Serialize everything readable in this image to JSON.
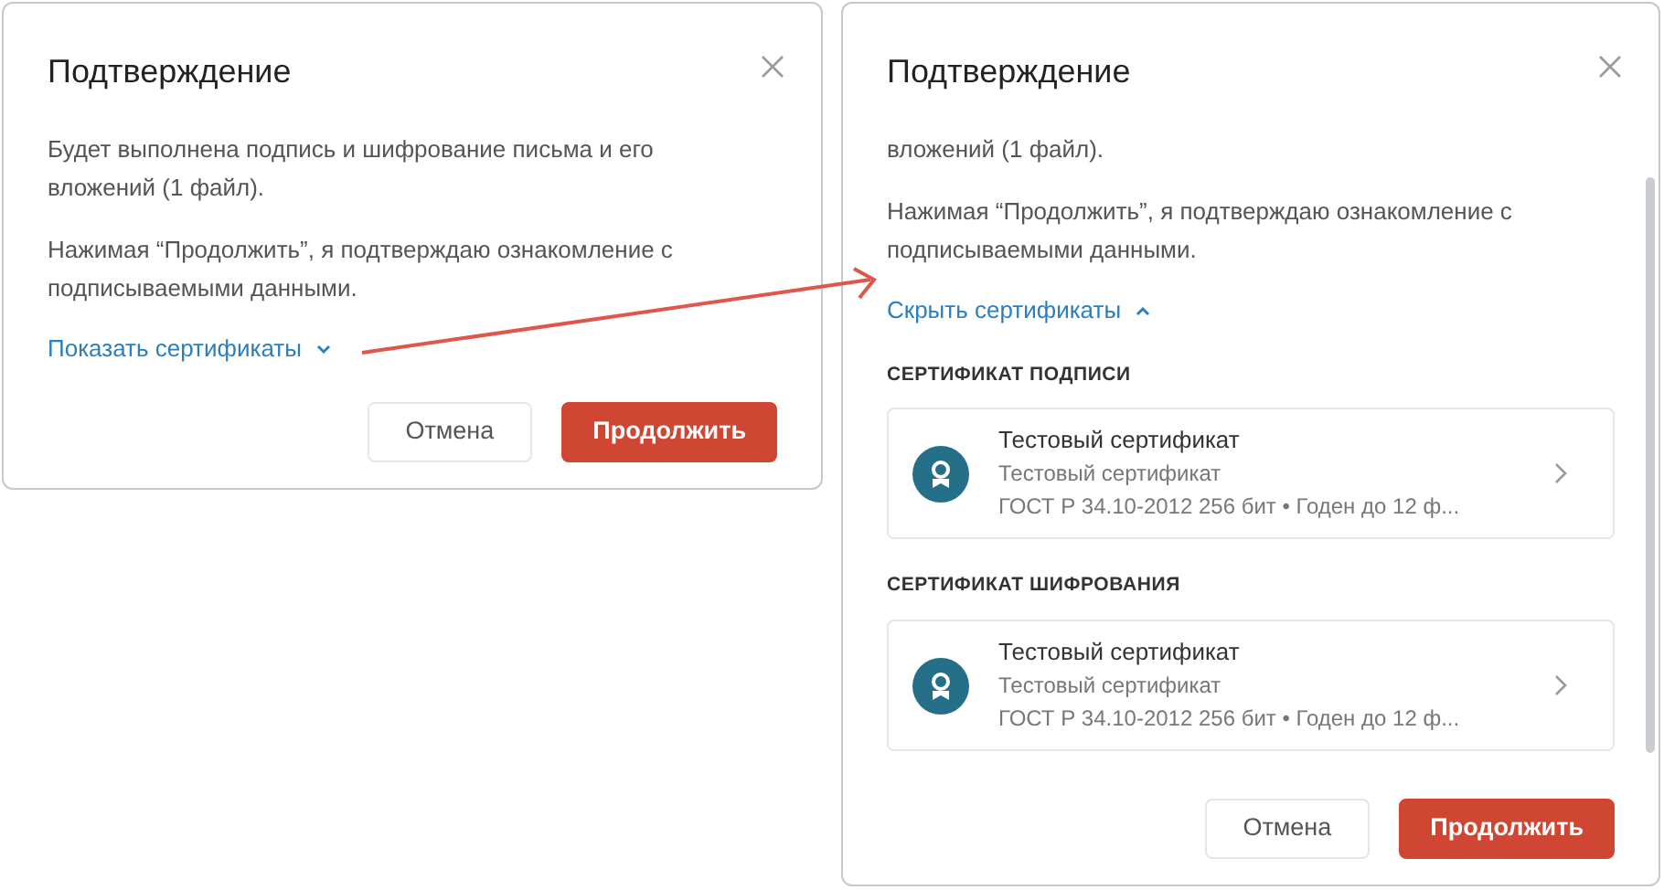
{
  "dialogs": [
    {
      "title": "Подтверждение",
      "paragraphs": [
        "Будет выполнена подпись и шифрование письма и его вложений (1 файл).",
        "Нажимая “Продолжить”, я подтверждаю ознакомление с подписываемыми данными."
      ],
      "toggle": {
        "label": "Показать сертификаты",
        "expanded": false
      },
      "buttons": [
        {
          "label": "Отмена",
          "kind": "secondary"
        },
        {
          "label": "Продолжить",
          "kind": "primary"
        }
      ]
    },
    {
      "title": "Подтверждение",
      "paragraphs": [
        "вложений (1 файл).",
        "Нажимая “Продолжить”, я подтверждаю ознакомление с подписываемыми данными."
      ],
      "toggle": {
        "label": "Скрыть сертификаты",
        "expanded": true
      },
      "sections": [
        {
          "heading": "СЕРТИФИКАТ ПОДПИСИ",
          "certificate": {
            "name": "Тестовый сертификат",
            "issuer": "Тестовый сертификат",
            "details": "ГОСТ Р 34.10-2012 256 бит • Годен до 12 ф..."
          }
        },
        {
          "heading": "СЕРТИФИКАТ ШИФРОВАНИЯ",
          "certificate": {
            "name": "Тестовый сертификат",
            "issuer": "Тестовый сертификат",
            "details": "ГОСТ Р 34.10-2012 256 бит • Годен до 12 ф..."
          }
        }
      ],
      "buttons": [
        {
          "label": "Отмена",
          "kind": "secondary"
        },
        {
          "label": "Продолжить",
          "kind": "primary"
        }
      ]
    }
  ]
}
